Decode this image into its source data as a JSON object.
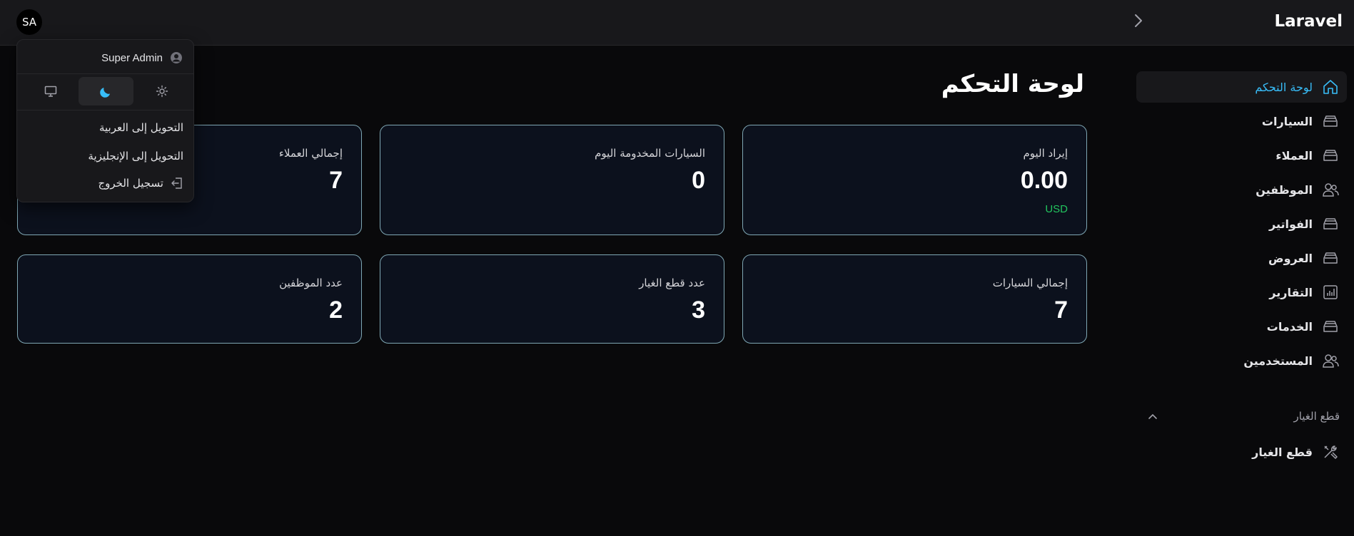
{
  "app": {
    "brand": "Laravel"
  },
  "header": {
    "avatar_initials": "SA"
  },
  "sidebar": {
    "items": [
      {
        "label": "لوحة التحكم",
        "icon": "home-icon",
        "active": true
      },
      {
        "label": "السيارات",
        "icon": "stack-icon"
      },
      {
        "label": "العملاء",
        "icon": "stack-icon"
      },
      {
        "label": "الموظفين",
        "icon": "users-icon"
      },
      {
        "label": "الفواتير",
        "icon": "stack-icon"
      },
      {
        "label": "العروض",
        "icon": "stack-icon"
      },
      {
        "label": "التقارير",
        "icon": "chart-icon"
      },
      {
        "label": "الخدمات",
        "icon": "stack-icon"
      },
      {
        "label": "المستخدمين",
        "icon": "users-icon"
      }
    ],
    "group": {
      "label": "قطع الغيار",
      "items": [
        {
          "label": "قطع الغيار",
          "icon": "tools-icon"
        }
      ]
    }
  },
  "main": {
    "title": "لوحة التحكم",
    "stats": [
      {
        "label": "إيراد اليوم",
        "value": "0.00",
        "sub": "USD"
      },
      {
        "label": "السيارات المخدومة اليوم",
        "value": "0"
      },
      {
        "label": "إجمالي العملاء",
        "value": "7"
      },
      {
        "label": "إجمالي السيارات",
        "value": "7"
      },
      {
        "label": "عدد قطع الغيار",
        "value": "3"
      },
      {
        "label": "عدد الموظفين",
        "value": "2"
      }
    ]
  },
  "user_menu": {
    "user_name": "Super Admin",
    "theme": {
      "active": "dark",
      "options": [
        "light",
        "dark",
        "system"
      ]
    },
    "items": [
      {
        "label": "التحويل إلى العربية"
      },
      {
        "label": "التحويل إلى الإنجليزية"
      },
      {
        "label": "تسجيل الخروج",
        "icon": "logout-icon"
      }
    ]
  },
  "colors": {
    "accent": "#38bdf8",
    "success": "#22c55e",
    "card_border": "#7fa7b4",
    "background": "#09090b"
  }
}
